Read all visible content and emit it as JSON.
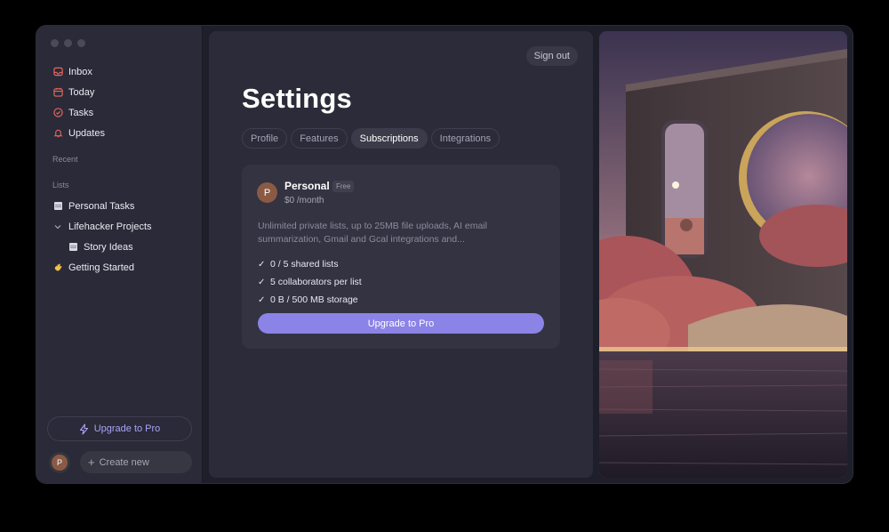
{
  "sidebar": {
    "nav": [
      {
        "label": "Inbox",
        "icon": "inbox-icon"
      },
      {
        "label": "Today",
        "icon": "calendar-icon"
      },
      {
        "label": "Tasks",
        "icon": "check-circle-icon"
      },
      {
        "label": "Updates",
        "icon": "bell-icon"
      }
    ],
    "recent_label": "Recent",
    "lists_label": "Lists",
    "lists": [
      {
        "label": "Personal Tasks",
        "icon": "document-icon"
      },
      {
        "label": "Lifehacker Projects",
        "icon": "chevron-down-icon"
      },
      {
        "label": "Story Ideas",
        "icon": "document-icon"
      },
      {
        "label": "Getting Started",
        "icon": "wave-hand-icon"
      }
    ],
    "upgrade_label": "Upgrade to Pro",
    "avatar_initial": "P",
    "create_new_label": "Create new"
  },
  "main": {
    "sign_out_label": "Sign out",
    "title": "Settings",
    "tabs": [
      {
        "label": "Profile",
        "active": false
      },
      {
        "label": "Features",
        "active": false
      },
      {
        "label": "Subscriptions",
        "active": true
      },
      {
        "label": "Integrations",
        "active": false
      }
    ],
    "plan": {
      "avatar_initial": "P",
      "name": "Personal",
      "badge": "Free",
      "price": "$0 /month",
      "description": "Unlimited private lists, up to 25MB file uploads, AI email summarization, Gmail and Gcal integrations and...",
      "features": [
        "0 / 5 shared lists",
        "5 collaborators per list",
        "0 B / 500 MB storage"
      ],
      "check_glyph": "✓",
      "upgrade_label": "Upgrade to Pro"
    }
  },
  "colors": {
    "accent": "#8b83e6",
    "icon_red": "#e8675f",
    "window_bg": "#1f1f2b",
    "card_bg": "#333342"
  }
}
